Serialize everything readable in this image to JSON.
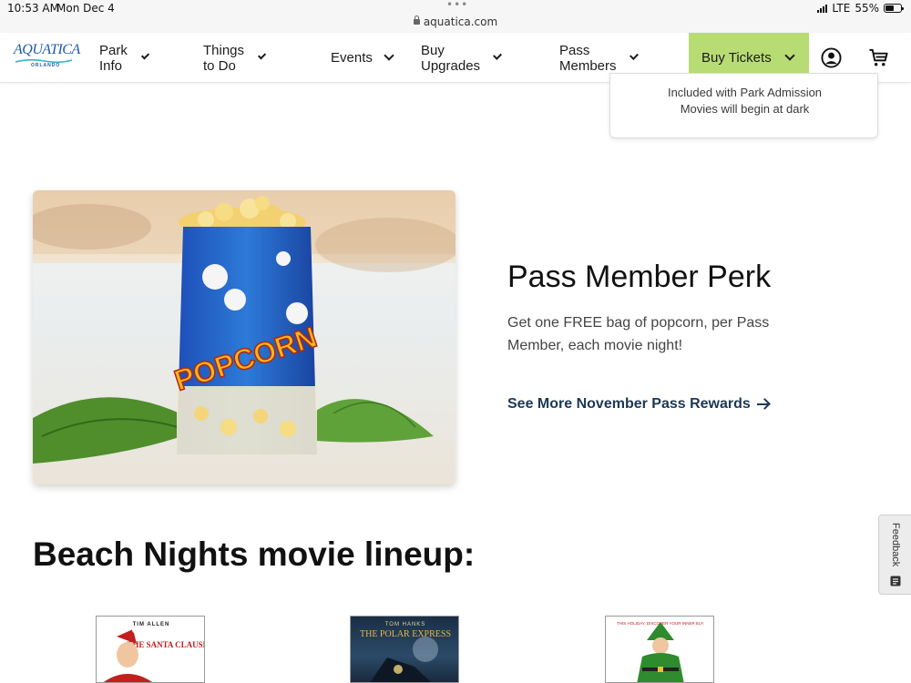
{
  "status_bar": {
    "time": "10:53 AM",
    "date": "Mon Dec 4",
    "url": "aquatica.com",
    "network": "LTE",
    "battery": "55%",
    "battery_level": 0.55
  },
  "header": {
    "logo_text": "AQUATICA",
    "logo_sub": "ORLANDO",
    "nav": [
      {
        "label": "Park Info"
      },
      {
        "label": "Things to Do"
      },
      {
        "label": "Events"
      },
      {
        "label": "Buy Upgrades"
      },
      {
        "label": "Pass Members"
      }
    ],
    "buy_tickets_label": "Buy Tickets",
    "buy_tickets_color": "#b8dc74",
    "account_icon": "account-circle-icon",
    "cart_icon": "shopping-cart-icon"
  },
  "event_card": {
    "line1": "Included with Park Admission",
    "line2": "Movies will begin at dark"
  },
  "perk": {
    "image_text": "POPCORN",
    "title": "Pass Member Perk",
    "description": "Get one FREE bag of popcorn, per Pass Member, each movie night!",
    "link_label": "See More November Pass Rewards",
    "link_color": "#1d3756"
  },
  "lineup": {
    "title": "Beach Nights movie lineup:",
    "posters": [
      {
        "top": "TIM ALLEN",
        "title": "THE SANTA CLAUSE"
      },
      {
        "top": "TOM HANKS",
        "title": "THE POLAR EXPRESS"
      },
      {
        "top": "THIS HOLIDAY, DISCOVER YOUR INNER ELF.",
        "title": ""
      }
    ]
  },
  "feedback": {
    "label": "Feedback"
  }
}
